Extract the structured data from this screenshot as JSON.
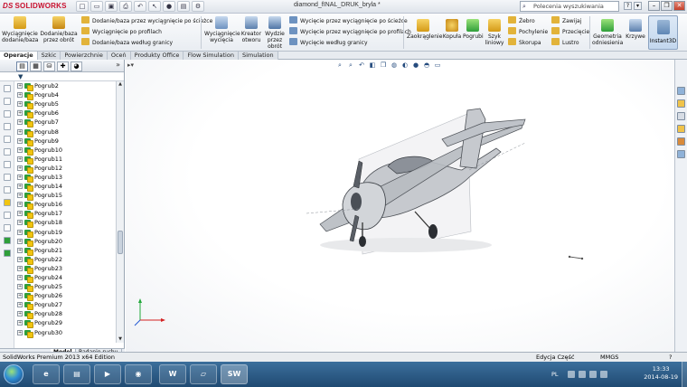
{
  "app": {
    "logo_prefix": "DS",
    "logo_text": "SOLIDWORKS",
    "document_title": "diamond_fINAL_DRUK_bryla *",
    "search_placeholder": "Polecenia wyszukiwania"
  },
  "ribbon": {
    "big_buttons": [
      {
        "label": "Wyciągnięcie dodanie/baza",
        "name": "extruded-boss-base-button"
      },
      {
        "label": "Dodanie/baza przez obrót",
        "name": "revolved-boss-base-button"
      },
      {
        "label": "Wyciągnięcie wycięcia",
        "name": "extruded-cut-button"
      },
      {
        "label": "Kreator otworu",
        "name": "hole-wizard-button"
      },
      {
        "label": "Wydzie przez obrót",
        "name": "revolved-cut-button"
      },
      {
        "label": "Zaokrąglenie",
        "name": "fillet-button"
      },
      {
        "label": "Kopuła",
        "name": "dome-button"
      },
      {
        "label": "Pogrubi",
        "name": "thicken-button"
      },
      {
        "label": "Szyk liniowy",
        "name": "linear-pattern-button"
      },
      {
        "label": "Geometria odniesienia",
        "name": "reference-geometry-button"
      },
      {
        "label": "Krzywe",
        "name": "curves-button"
      }
    ],
    "small_buttons": [
      {
        "label": "Dodanie/baza przez wyciągnięcie po ścieżce",
        "name": "swept-boss-button"
      },
      {
        "label": "Wyciągnięcie po profilach",
        "name": "lofted-boss-button"
      },
      {
        "label": "Dodanie/baza według granicy",
        "name": "boundary-boss-button"
      },
      {
        "label": "Wycięcie przez wyciągnięcie po ścieżce",
        "name": "swept-cut-button"
      },
      {
        "label": "Wycięcie przez wyciągnięcie po profilach",
        "name": "lofted-cut-button"
      },
      {
        "label": "Wycięcie według granicy",
        "name": "boundary-cut-button"
      },
      {
        "label": "Żebro",
        "name": "rib-button"
      },
      {
        "label": "Pochylenie",
        "name": "draft-button"
      },
      {
        "label": "Skorupa",
        "name": "shell-button"
      },
      {
        "label": "Zawijaj",
        "name": "wrap-button"
      },
      {
        "label": "Przecięcie",
        "name": "intersect-button"
      },
      {
        "label": "Lustro",
        "name": "mirror-button"
      }
    ],
    "instant3d": "Instant3D"
  },
  "tabs": [
    "Operacje",
    "Szkic",
    "Powierzchnie",
    "Oceń",
    "Produkty Office",
    "Flow Simulation",
    "Simulation"
  ],
  "active_tab": "Operacje",
  "tree": {
    "items": [
      "Pogrub2",
      "Pogrub4",
      "Pogrub5",
      "Pogrub6",
      "Pogrub7",
      "Pogrub8",
      "Pogrub9",
      "Pogrub10",
      "Pogrub11",
      "Pogrub12",
      "Pogrub13",
      "Pogrub14",
      "Pogrub15",
      "Pogrub16",
      "Pogrub17",
      "Pogrub18",
      "Pogrub19",
      "Pogrub20",
      "Pogrub21",
      "Pogrub22",
      "Pogrub23",
      "Pogrub24",
      "Pogrub25",
      "Pogrub26",
      "Pogrub27",
      "Pogrub28",
      "Pogrub29",
      "Pogrub30"
    ]
  },
  "bottom_tabs": [
    "Model",
    "Badanie ruchu"
  ],
  "statusbar": {
    "left": "SolidWorks Premium 2013 x64 Edition",
    "mode": "Edycja Część",
    "units": "MMGS",
    "help": "?"
  },
  "taskbar": {
    "lang": "PL",
    "time": "13:33",
    "date": "2014-08-19",
    "apps": [
      {
        "name": "ie-taskbar-icon",
        "glyph": "e"
      },
      {
        "name": "explorer-taskbar-icon",
        "glyph": "▤"
      },
      {
        "name": "media-player-taskbar-icon",
        "glyph": "▶"
      },
      {
        "name": "firefox-taskbar-icon",
        "glyph": "◉"
      },
      {
        "name": "word-taskbar-icon",
        "glyph": "W"
      },
      {
        "name": "paint-taskbar-icon",
        "glyph": "▱"
      },
      {
        "name": "solidworks-taskbar-icon",
        "glyph": "SW"
      }
    ]
  },
  "colors": {
    "brand_red": "#c8102e",
    "feature_green": "#2f9f3a",
    "taskbar_blue": "#1f4a72"
  }
}
